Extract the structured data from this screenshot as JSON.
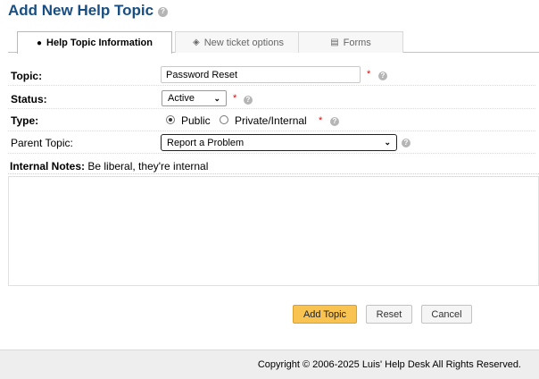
{
  "page": {
    "title": "Add New Help Topic"
  },
  "tabs": [
    {
      "label": "Help Topic Information",
      "icon": "info-circle-icon",
      "active": true
    },
    {
      "label": "New ticket options",
      "icon": "tag-icon",
      "active": false
    },
    {
      "label": "Forms",
      "icon": "forms-icon",
      "active": false
    }
  ],
  "form": {
    "topic": {
      "label": "Topic:",
      "value": "Password Reset"
    },
    "status": {
      "label": "Status:",
      "value": "Active"
    },
    "type": {
      "label": "Type:",
      "options": [
        "Public",
        "Private/Internal"
      ],
      "selected": "Public"
    },
    "parent_topic": {
      "label": "Parent Topic:",
      "value": "Report a Problem"
    },
    "internal_notes": {
      "label": "Internal Notes:",
      "hint": "Be liberal, they're internal",
      "value": ""
    },
    "required_mark": "*",
    "help_mark": "?"
  },
  "buttons": {
    "add": "Add Topic",
    "reset": "Reset",
    "cancel": "Cancel"
  },
  "footer": {
    "copyright": "Copyright © 2006-2025 Luis' Help Desk All Rights Reserved."
  },
  "colors": {
    "title": "#184e81",
    "primary_button": "#f8c350",
    "required": "#ee0000"
  }
}
